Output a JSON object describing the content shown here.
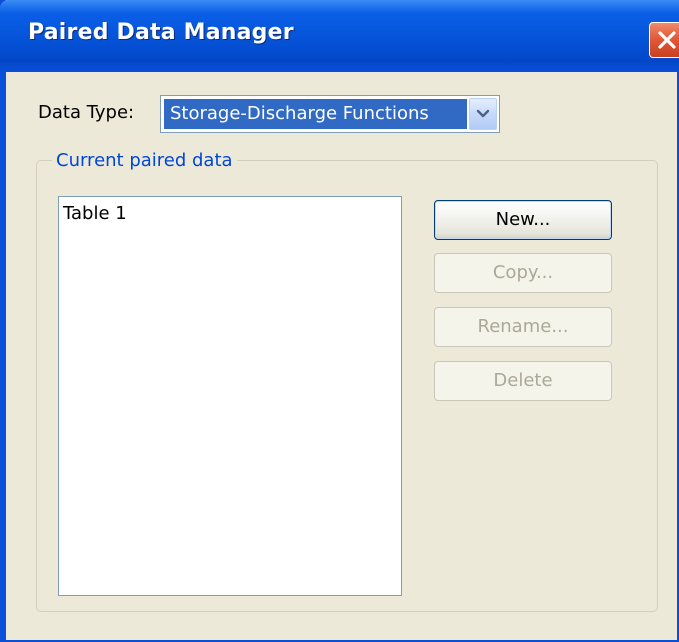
{
  "window": {
    "title": "Paired Data Manager"
  },
  "data_type": {
    "label": "Data Type:",
    "selected": "Storage-Discharge Functions"
  },
  "group": {
    "legend": "Current paired data"
  },
  "list": {
    "items": [
      "Table 1"
    ]
  },
  "buttons": {
    "new": "New...",
    "copy": "Copy...",
    "rename": "Rename...",
    "delete": "Delete"
  },
  "colors": {
    "title_bar": "#0553d8",
    "close_button": "#e25a38",
    "selection": "#316ac5",
    "group_legend": "#0046d5",
    "disabled_text": "#aca899"
  },
  "icons": {
    "close": "close-icon",
    "dropdown": "chevron-down-icon"
  }
}
